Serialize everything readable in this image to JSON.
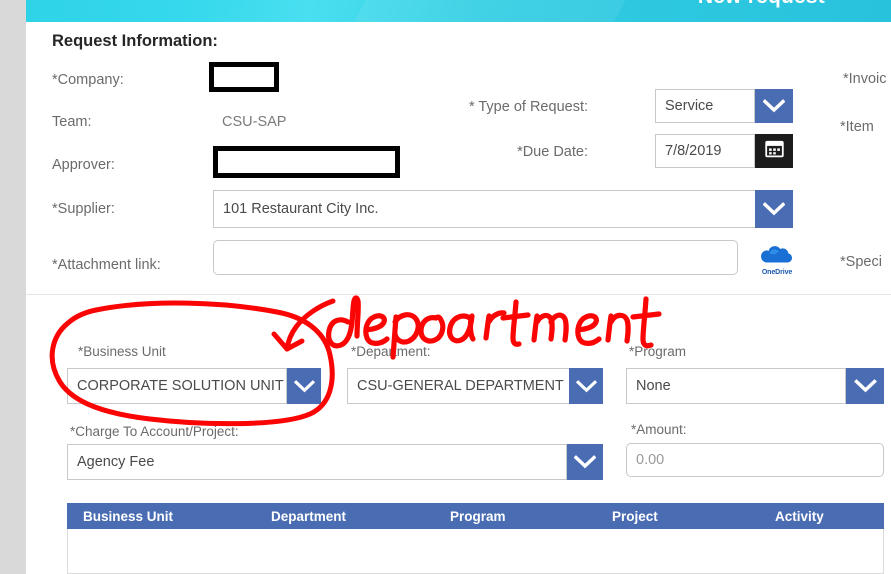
{
  "banner": {
    "title": "New request"
  },
  "form": {
    "section_title": "Request Information:",
    "company_label": "*Company:",
    "company_value": "",
    "team_label": "Team:",
    "team_value": "CSU-SAP",
    "approver_label": "Approver:",
    "approver_value": "",
    "supplier_label": "*Supplier:",
    "supplier_value": "101 Restaurant City Inc.",
    "attachment_label": "*Attachment link:",
    "attachment_value": "",
    "type_label": "* Type of Request:",
    "type_value": "Service",
    "due_date_label": "*Due Date:",
    "due_date_value": "7/8/2019",
    "onedrive_label": "OneDrive",
    "right_labels": [
      "*Invoic",
      "*Item ",
      "*Speci"
    ]
  },
  "charge": {
    "business_unit_label": "*Business Unit",
    "business_unit_value": "CORPORATE SOLUTION UNIT",
    "department_label": "*Department:",
    "department_value": "CSU-GENERAL DEPARTMENT",
    "program_label": "*Program",
    "program_value": "None",
    "account_label": "*Charge To Account/Project:",
    "account_value": "Agency Fee",
    "amount_label": "*Amount:",
    "amount_value": "0.00"
  },
  "grid": {
    "columns": [
      "Business Unit",
      "Department",
      "Program",
      "Project",
      "Activity"
    ]
  },
  "annotation": {
    "text": "department",
    "color": "#fb0404"
  },
  "colors": {
    "banner_cyan": "#31d4e9",
    "dropdown_blue": "#4a6cb3",
    "grid_header_blue": "#4a6cb3",
    "annotation_red": "#fb0404",
    "gutter_gray": "#d9d9d9",
    "calendar_black": "#1c1c1c"
  }
}
